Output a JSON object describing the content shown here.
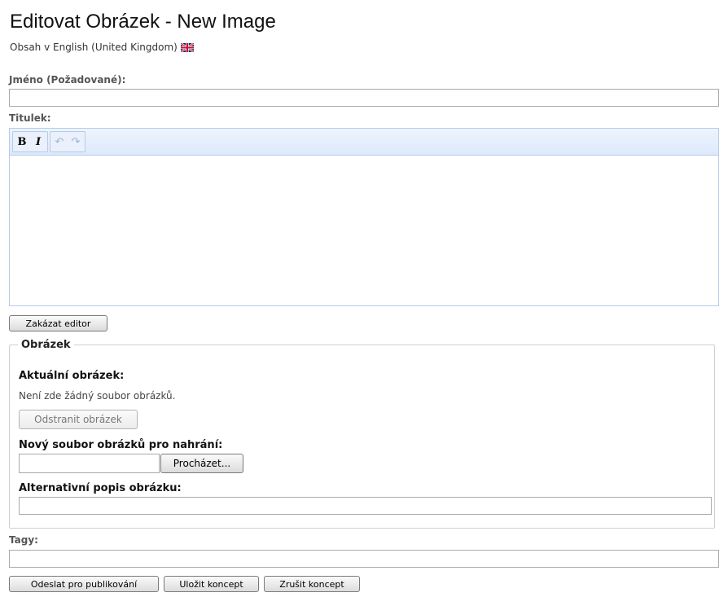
{
  "header": {
    "title": "Editovat Obrázek - New Image",
    "subtitle": "Obsah v English (United Kingdom)",
    "flag_icon": "uk-flag-icon"
  },
  "form": {
    "name_label": "Jméno (Požadované):",
    "name_value": "",
    "caption_label": "Titulek:",
    "caption_value": "",
    "toolbar": {
      "bold_label": "B",
      "italic_label": "I",
      "undo_icon": "undo-icon",
      "redo_icon": "redo-icon"
    },
    "disable_editor_label": "Zakázat editor",
    "image_section": {
      "legend": "Obrázek",
      "current_label": "Aktuální obrázek:",
      "no_image_text": "Není zde žádný soubor obrázků.",
      "remove_button": "Odstranit obrázek",
      "new_file_label": "Nový soubor obrázků pro nahrání:",
      "file_value": "",
      "browse_button": "Procházet...",
      "alt_label": "Alternativní popis obrázku:",
      "alt_value": ""
    },
    "tags_label": "Tagy:",
    "tags_value": ""
  },
  "actions": {
    "submit_label": "Odeslat pro publikování",
    "save_draft_label": "Uložit koncept",
    "cancel_draft_label": "Zrušit koncept"
  }
}
